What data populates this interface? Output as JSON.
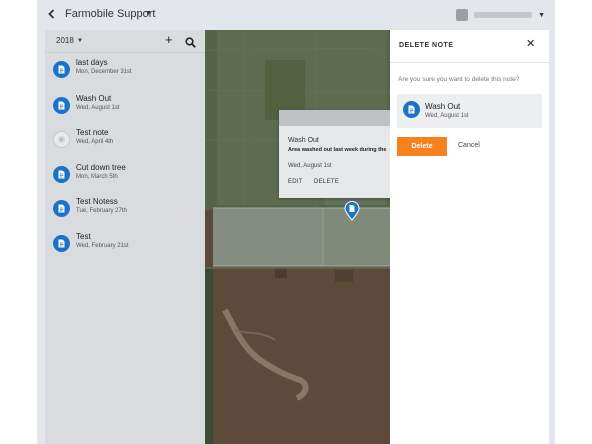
{
  "header": {
    "org_title": "Farmobile Support"
  },
  "sidebar": {
    "year": "2018",
    "notes": [
      {
        "title": "last days",
        "date": "Mon, December 31st",
        "icon": "document-icon"
      },
      {
        "title": "Wash Out",
        "date": "Wed, August 1st",
        "icon": "document-icon"
      },
      {
        "title": "Test note",
        "date": "Wed, April 4th",
        "icon": "image-thumbnail-icon"
      },
      {
        "title": "Cut down tree",
        "date": "Mon, March 5th",
        "icon": "document-icon"
      },
      {
        "title": "Test Notess",
        "date": "Tue, February 27th",
        "icon": "document-icon"
      },
      {
        "title": "Test",
        "date": "Wed, February 21st",
        "icon": "document-icon"
      }
    ]
  },
  "map_popup": {
    "title": "Wash Out",
    "body": "Area washed out last week during the",
    "date": "Wed, August 1st",
    "edit_label": "EDIT",
    "delete_label": "DELETE"
  },
  "delete_panel": {
    "title": "DELETE NOTE",
    "question": "Are you sure you want to delete this note?",
    "note_title": "Wash Out",
    "note_date": "Wed, August 1st",
    "delete_label": "Delete",
    "cancel_label": "Cancel"
  },
  "colors": {
    "accent_blue": "#1a73c8",
    "delete_orange": "#f5821f"
  }
}
